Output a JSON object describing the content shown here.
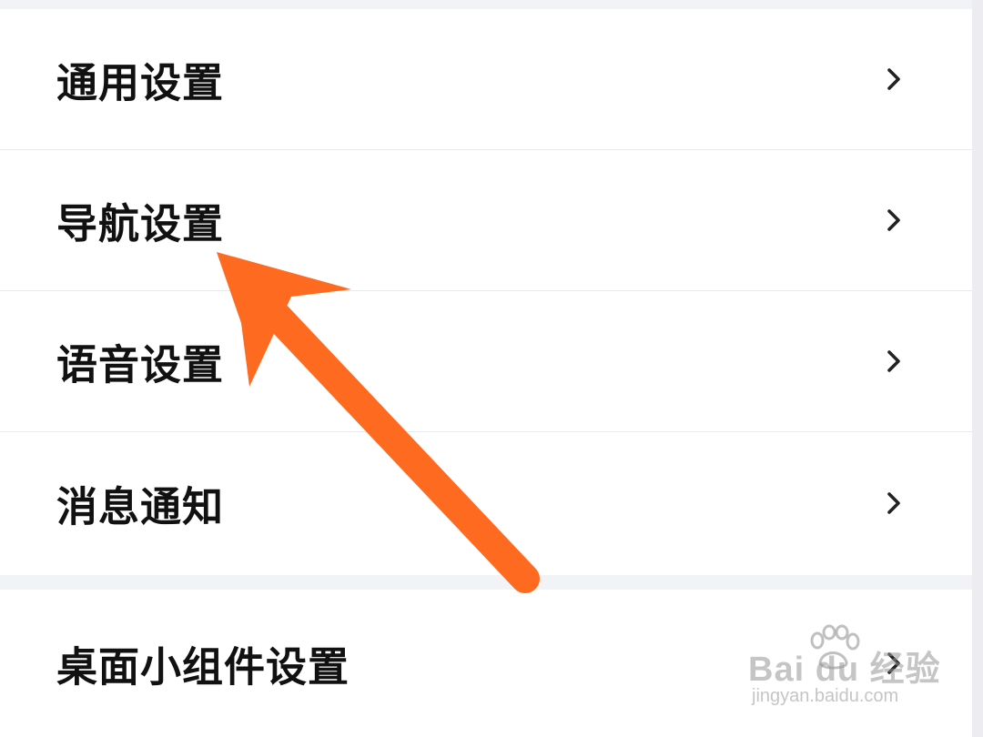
{
  "settings_group_main": {
    "items": [
      {
        "label": "通用设置"
      },
      {
        "label": "导航设置"
      },
      {
        "label": "语音设置"
      },
      {
        "label": "消息通知"
      }
    ]
  },
  "settings_group_secondary": {
    "items": [
      {
        "label": "桌面小组件设置"
      }
    ]
  },
  "annotation": {
    "arrow_color": "#ff6a21",
    "points_to": "导航设置"
  },
  "watermark": {
    "brand": "Bai du 经验",
    "url": "jingyan.baidu.com"
  },
  "colors": {
    "background": "#f2f3f7",
    "card": "#ffffff",
    "text": "#111111"
  }
}
